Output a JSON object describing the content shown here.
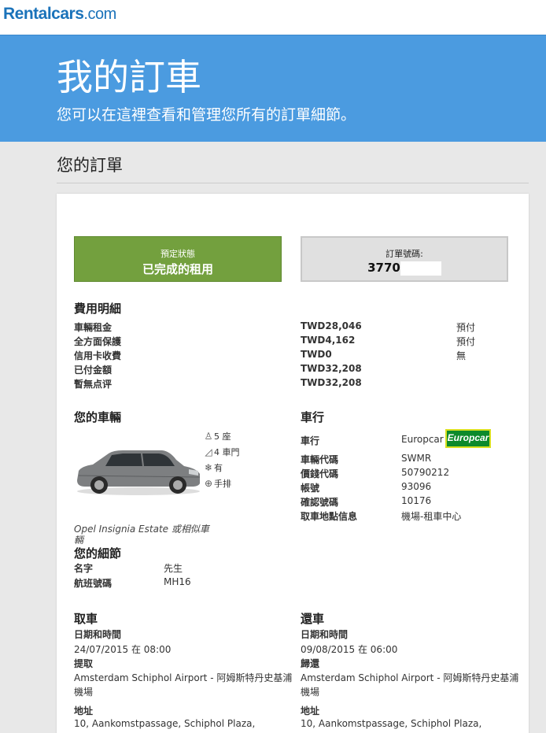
{
  "logo": {
    "part1": "Rentalcars",
    "part2": ".com"
  },
  "hero": {
    "title": "我的訂車",
    "subtitle": "您可以在這裡查看和管理您所有的訂單細節。"
  },
  "section_title": "您的訂單",
  "status": {
    "label": "預定狀態",
    "value": "已完成的租用"
  },
  "order": {
    "label": "訂單號碼:",
    "value": "3770"
  },
  "costs": {
    "title": "費用明細",
    "rows": [
      {
        "name": "車輛租金",
        "amount": "TWD28,046",
        "note": "預付"
      },
      {
        "name": "全方面保護",
        "amount": "TWD4,162",
        "note": "預付"
      },
      {
        "name": "信用卡收費",
        "amount": "TWD0",
        "note": "無"
      },
      {
        "name": "已付金額",
        "amount": "TWD32,208",
        "note": ""
      },
      {
        "name": "暫無点评",
        "amount": "TWD32,208",
        "note": ""
      }
    ]
  },
  "vehicle": {
    "title": "您的車輛",
    "specs": [
      {
        "icon": "person-icon",
        "text": "5 座"
      },
      {
        "icon": "car-door-icon",
        "text": "4 車門"
      },
      {
        "icon": "snowflake-icon",
        "text": "有"
      },
      {
        "icon": "gearbox-icon",
        "text": "手排"
      }
    ],
    "name_line1": "Opel Insignia Estate 或相似車",
    "name_line2": "輛"
  },
  "supplier": {
    "title": "車行",
    "logo_text": "Europcar",
    "rows": [
      {
        "label": "車行",
        "value": "Europcar"
      },
      {
        "label": "車輛代碼",
        "value": "SWMR"
      },
      {
        "label": "價錢代碼",
        "value": "50790212"
      },
      {
        "label": "帳號",
        "value": "93096"
      },
      {
        "label": "確認號碼",
        "value": "10176"
      },
      {
        "label": "取車地點信息",
        "value": "機場-租車中心"
      }
    ]
  },
  "details": {
    "title": "您的細節",
    "rows": [
      {
        "label": "名字",
        "value": "先生"
      },
      {
        "label": "航班號碼",
        "value": "MH16"
      }
    ]
  },
  "pickup": {
    "title": "取車",
    "datetime_label": "日期和時間",
    "datetime": "24/07/2015 在 08:00",
    "place_label": "提取",
    "place_line1": "Amsterdam Schiphol Airport - 阿姆斯特丹史基浦",
    "place_line2": "機場",
    "address_label": "地址",
    "address": "10, Aankomstpassage, Schiphol Plaza,"
  },
  "dropoff": {
    "title": "還車",
    "datetime_label": "日期和時間",
    "datetime": "09/08/2015 在 06:00",
    "place_label": "歸還",
    "place_line1": "Amsterdam Schiphol Airport - 阿姆斯特丹史基浦",
    "place_line2": "機場",
    "address_label": "地址",
    "address": "10, Aankomstpassage, Schiphol Plaza,"
  }
}
